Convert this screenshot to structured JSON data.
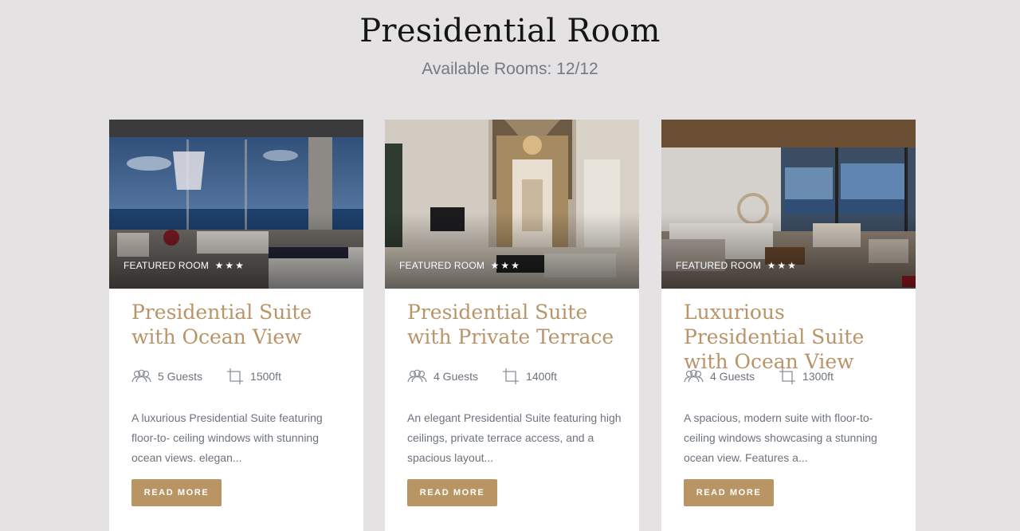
{
  "page": {
    "title": "Presidential Room",
    "subtitle": "Available Rooms: 12/12"
  },
  "colors": {
    "accent": "#b89468",
    "button": "#ba9564",
    "background": "#e4e2e3"
  },
  "cards": [
    {
      "badge": "FEATURED ROOM",
      "stars": "★★★",
      "title": "Presidential Suite with Ocean View",
      "guests": "5 Guests",
      "size": "1500ft",
      "description": "A luxurious Presidential Suite featuring floor-to- ceiling windows with stunning ocean views. elegan...",
      "button": "READ MORE",
      "guests_icon": "guests-icon",
      "size_icon": "crop-area-icon"
    },
    {
      "badge": "FEATURED ROOM",
      "stars": "★★★",
      "title": "Presidential Suite with Private Terrace",
      "guests": "4 Guests",
      "size": "1400ft",
      "description": "An elegant Presidential Suite featuring high ceilings, private terrace access, and a spacious layout...",
      "button": "READ MORE",
      "guests_icon": "guests-icon",
      "size_icon": "crop-area-icon"
    },
    {
      "badge": "FEATURED ROOM",
      "stars": "★★★",
      "title": "Luxurious Presidential Suite with Ocean View",
      "guests": "4 Guests",
      "size": "1300ft",
      "description": "A spacious, modern suite with floor-to-ceiling windows showcasing a stunning ocean view. Features a...",
      "button": "READ MORE",
      "guests_icon": "guests-icon",
      "size_icon": "crop-area-icon"
    }
  ]
}
